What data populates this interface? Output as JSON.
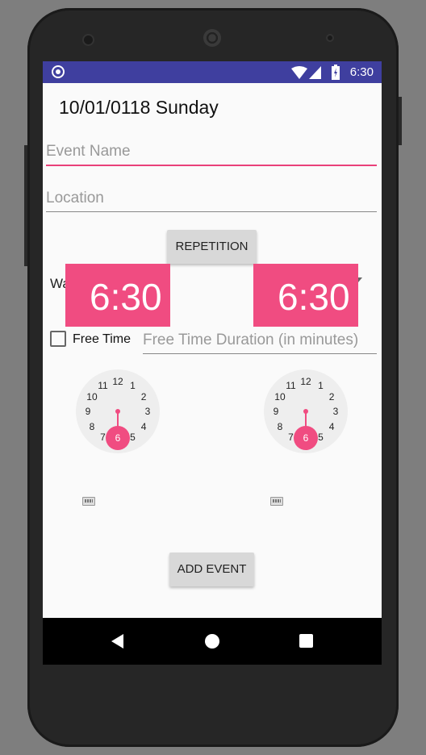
{
  "status_bar": {
    "time": "6:30",
    "icons": [
      "circle-icon",
      "wifi-icon",
      "signal-icon",
      "battery-icon"
    ]
  },
  "header": {
    "date": "10/01/0118 Sunday"
  },
  "form": {
    "event_name_placeholder": "Event Name",
    "location_placeholder": "Location",
    "repetition_button": "REPETITION",
    "spinner_partial_text": "Wa",
    "start_time": "6:30",
    "end_time": "6:30",
    "free_time_label": "Free Time",
    "free_time_checked": false,
    "free_time_duration_placeholder": "Free Time Duration (in minutes)",
    "add_event_button": "ADD EVENT"
  },
  "clocks": {
    "numbers": [
      "12",
      "1",
      "2",
      "3",
      "4",
      "5",
      "6",
      "7",
      "8",
      "9",
      "10",
      "11"
    ],
    "selected_hour": "6"
  },
  "colors": {
    "accent": "#f04c81",
    "status_bar": "#3f3f9f",
    "background": "#fafafa"
  }
}
